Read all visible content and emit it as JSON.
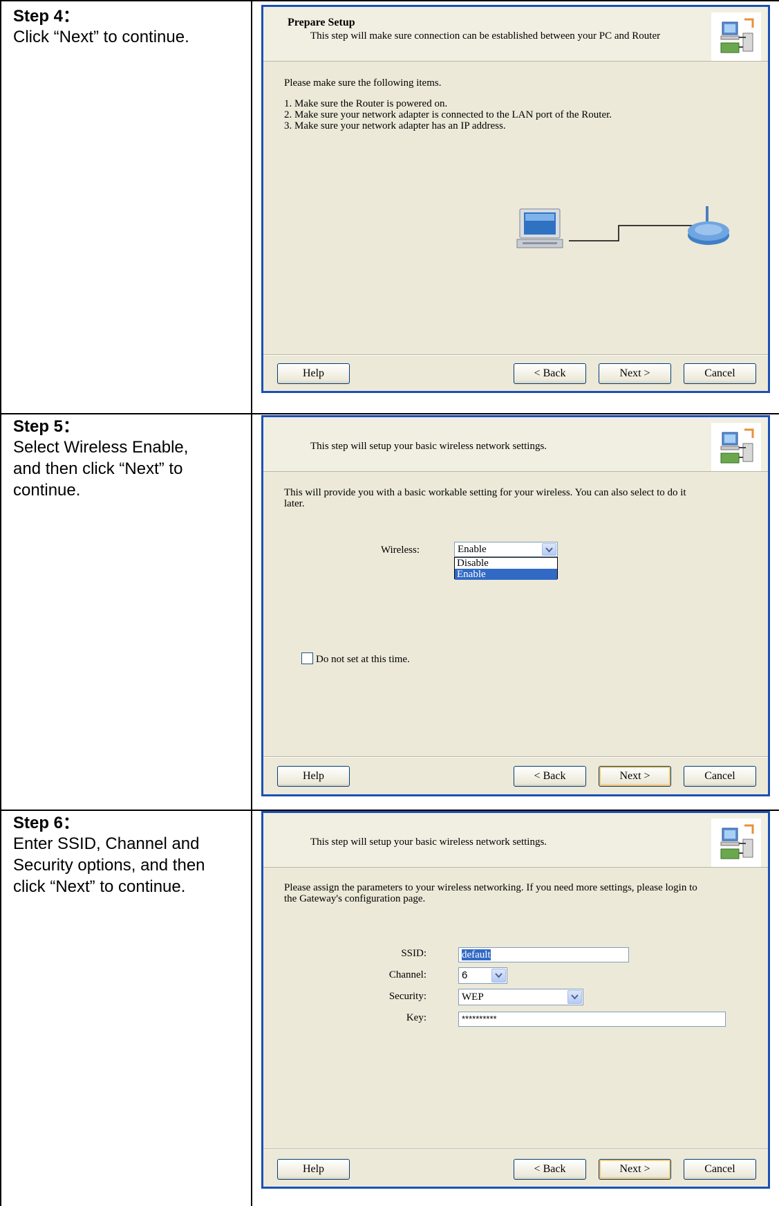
{
  "steps": [
    {
      "title": "Step 4：",
      "description_lines": [
        "Click “Next” to continue."
      ],
      "dialog": {
        "header_title": "Prepare Setup",
        "header_subtitle": "This step will make sure connection can be established between your PC and Router",
        "intro": "Please make sure the following items.",
        "items": [
          "1. Make sure the Router is powered on.",
          "2. Make sure your network adapter is connected to the LAN port of the Router.",
          "3. Make sure your network adapter has an IP address."
        ],
        "illustration_icons": [
          "computer-icon",
          "router-icon"
        ]
      }
    },
    {
      "title": "Step 5：",
      "description_lines": [
        "Select Wireless Enable,",
        "and then click “Next” to",
        "continue."
      ],
      "dialog": {
        "header_subtitle": "This step will setup your basic wireless network settings.",
        "intro_lines": [
          "This will provide you with a basic workable setting for your wireless. You can also select to do it",
          "later."
        ],
        "wireless_label": "Wireless:",
        "wireless_value": "Enable",
        "wireless_options": [
          "Disable",
          "Enable"
        ],
        "wireless_highlighted": "Enable",
        "checkbox_label": "Do not set at this time.",
        "checkbox_checked": false
      }
    },
    {
      "title": "Step 6：",
      "description_lines": [
        "Enter SSID, Channel and",
        "Security options, and then",
        "click “Next” to continue."
      ],
      "dialog": {
        "header_subtitle": "This step will setup your basic wireless network settings.",
        "intro_lines": [
          "Please assign the parameters to your wireless networking. If you need more settings, please login to",
          "the Gateway's configuration page."
        ],
        "ssid_label": "SSID:",
        "ssid_value": "default",
        "channel_label": "Channel:",
        "channel_value": "6",
        "security_label": "Security:",
        "security_value": "WEP",
        "key_label": "Key:",
        "key_value": "**********"
      }
    }
  ],
  "buttons": {
    "help": "Help",
    "back": "< Back",
    "next": "Next >",
    "cancel": "Cancel"
  },
  "colors": {
    "dialog_border": "#1b4fb5",
    "dialog_bg": "#ece9d8",
    "selection": "#316ac5"
  }
}
